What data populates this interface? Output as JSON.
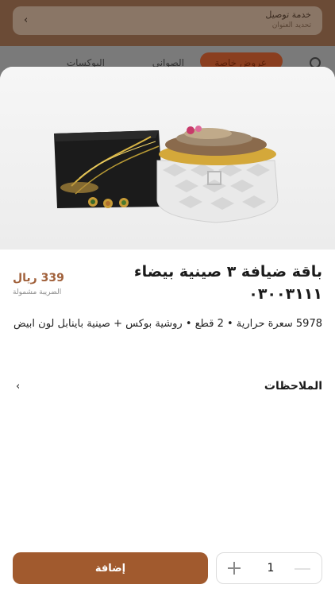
{
  "background": {
    "delivery": {
      "title": "خدمة توصيل",
      "subtitle": "تحديد العنوان"
    },
    "nav": {
      "items": [
        "عروض خاصة",
        "الصواني",
        "البوكسات"
      ]
    }
  },
  "product": {
    "title": "باقة ضيافة ٣ صينية بيضاء ٠٣٠٠٣١١١",
    "price": "339 ريال",
    "tax_note": "الضريبة مشمولة",
    "description": "5978 سعرة حرارية • 2 قطع • روشية بوكس + صينية باينابل لون ابيض",
    "image_alt": "Rocher"
  },
  "notes": {
    "label": "الملاحظات"
  },
  "actions": {
    "add_label": "إضافة",
    "quantity": "1"
  },
  "colors": {
    "accent": "#a15a2e",
    "price": "#a0603a"
  }
}
